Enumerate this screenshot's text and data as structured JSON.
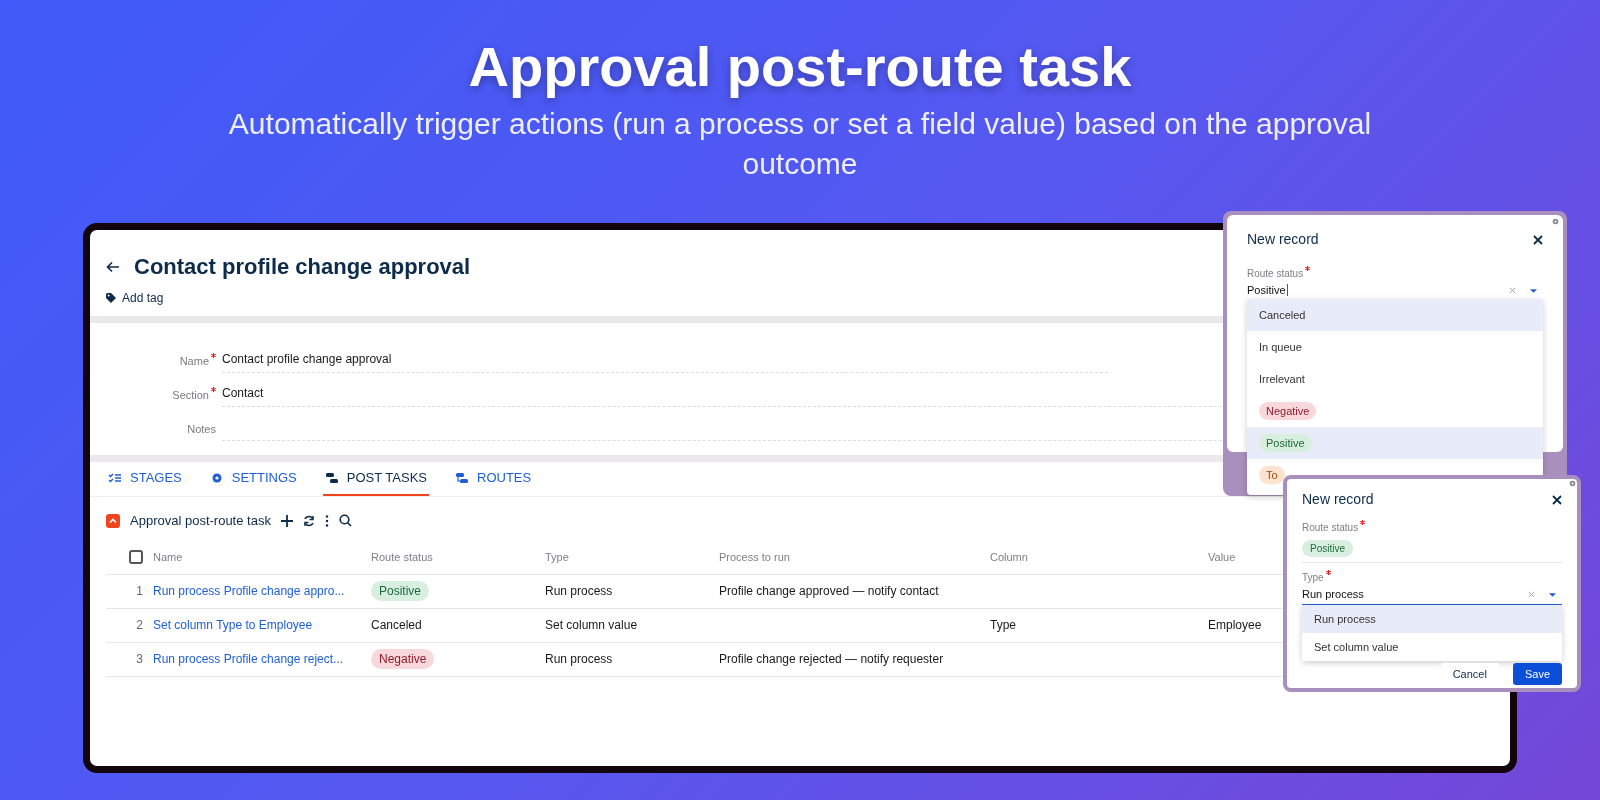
{
  "banner": {
    "title": "Approval post-route task",
    "subtitle": "Automatically trigger actions (run a process or set a field value) based on the approval outcome"
  },
  "record": {
    "title": "Contact profile change approval",
    "add_tag": "Add tag",
    "fields": [
      {
        "label": "Name",
        "required": true,
        "value": "Contact profile change approval"
      },
      {
        "label": "Section",
        "required": true,
        "value": "Contact"
      },
      {
        "label": "Notes"
      }
    ],
    "tabs": [
      {
        "label": "STAGES",
        "kind": "stages",
        "selected": false
      },
      {
        "label": "SETTINGS",
        "kind": "settings",
        "selected": false
      },
      {
        "label": "POST TASKS",
        "kind": "tasks",
        "selected": true
      },
      {
        "label": "ROUTES",
        "kind": "routes",
        "selected": false
      }
    ],
    "detail": {
      "title": "Approval post-route task",
      "expanded": true,
      "all_selected": false,
      "columns": [
        "Name",
        "Route status",
        "Type",
        "Process to run",
        "Column",
        "Value"
      ],
      "rows": [
        {
          "number": "1",
          "name": "Run process Profile change appro...",
          "route_status": {
            "text": "Positive",
            "kind": "positive"
          },
          "type": "Run process",
          "process": "Profile change approved — notify contact"
        },
        {
          "number": "2",
          "name": "Set column Type to Employee",
          "route_status": {
            "text": "Canceled",
            "kind": "plain"
          },
          "type": "Set column value",
          "column": "Type",
          "value": "Employee"
        },
        {
          "number": "3",
          "name": "Run process Profile change reject...",
          "route_status": {
            "text": "Negative",
            "kind": "negative"
          },
          "type": "Run process",
          "process": "Profile change rejected — notify requester"
        }
      ]
    }
  },
  "popups": [
    {
      "title": "New record",
      "field": {
        "label": "Route status",
        "required": true,
        "value": "Positive"
      },
      "options": [
        {
          "text": "Canceled",
          "kind": "plain",
          "highlighted": true
        },
        {
          "text": "In queue",
          "kind": "plain",
          "highlighted": false
        },
        {
          "text": "Irrelevant",
          "kind": "plain",
          "highlighted": false
        },
        {
          "text": "Negative",
          "kind": "negative",
          "highlighted": false
        },
        {
          "text": "Positive",
          "kind": "positive",
          "highlighted": true
        },
        {
          "text": "To",
          "kind": "pending",
          "highlighted": false
        }
      ]
    },
    {
      "title": "New record",
      "status_field": {
        "label": "Route status",
        "required": true,
        "value": "Positive",
        "kind": "positive"
      },
      "field": {
        "label": "Type",
        "required": true,
        "value": "Run process"
      },
      "options": [
        {
          "text": "Run process",
          "kind": "plain",
          "highlighted": true
        },
        {
          "text": "Set column value",
          "kind": "plain",
          "highlighted": false
        }
      ],
      "buttons": [
        {
          "label": "Cancel",
          "kind": "secondary"
        },
        {
          "label": "Save",
          "kind": "primary"
        }
      ]
    }
  ]
}
